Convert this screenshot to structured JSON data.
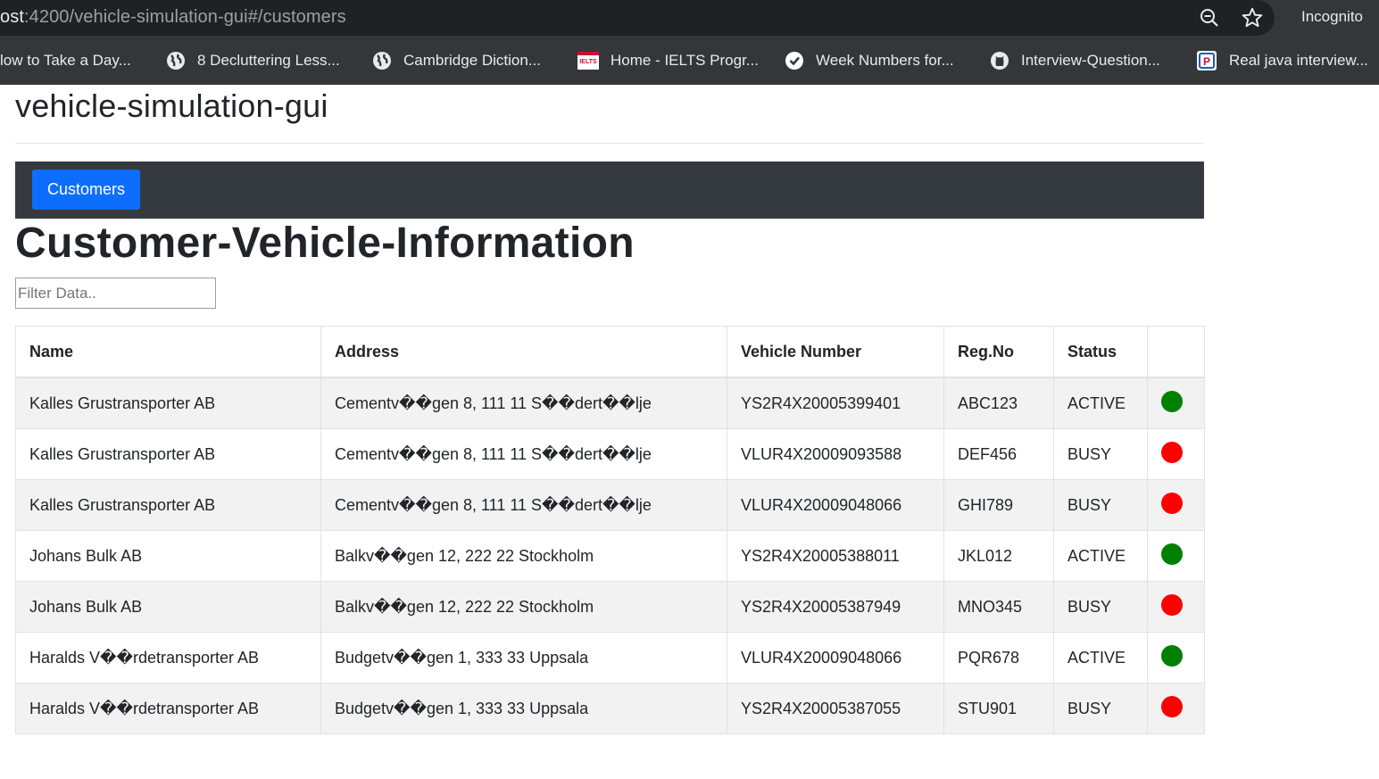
{
  "browser": {
    "url_host": "ost",
    "url_path": ":4200/vehicle-simulation-gui#/customers",
    "mode_label": "Incognito",
    "bookmarks": [
      {
        "label": "low to Take a Day...",
        "icon": "none"
      },
      {
        "label": "8 Decluttering Less...",
        "icon": "globe-icon"
      },
      {
        "label": "Cambridge Diction...",
        "icon": "globe-icon"
      },
      {
        "label": "Home - IELTS Progr...",
        "icon": "ielts-icon"
      },
      {
        "label": "Week Numbers for...",
        "icon": "check-circle-icon"
      },
      {
        "label": "Interview-Question...",
        "icon": "github-icon"
      },
      {
        "label": "Real java interview...",
        "icon": "p-icon"
      }
    ]
  },
  "app": {
    "title": "vehicle-simulation-gui",
    "nav": {
      "customers_label": "Customers"
    },
    "heading": "Customer-Vehicle-Information",
    "filter": {
      "placeholder": "Filter Data..",
      "value": ""
    }
  },
  "table": {
    "headers": [
      "Name",
      "Address",
      "Vehicle Number",
      "Reg.No",
      "Status",
      ""
    ],
    "rows": [
      {
        "name": "Kalles Grustransporter AB",
        "address": "Cementv��gen 8, 111 11 S��dert��lje",
        "vehicle_number": "YS2R4X20005399401",
        "reg_no": "ABC123",
        "status": "ACTIVE",
        "indicator": "green"
      },
      {
        "name": "Kalles Grustransporter AB",
        "address": "Cementv��gen 8, 111 11 S��dert��lje",
        "vehicle_number": "VLUR4X20009093588",
        "reg_no": "DEF456",
        "status": "BUSY",
        "indicator": "red"
      },
      {
        "name": "Kalles Grustransporter AB",
        "address": "Cementv��gen 8, 111 11 S��dert��lje",
        "vehicle_number": "VLUR4X20009048066",
        "reg_no": "GHI789",
        "status": "BUSY",
        "indicator": "red"
      },
      {
        "name": "Johans Bulk AB",
        "address": "Balkv��gen 12, 222 22 Stockholm",
        "vehicle_number": "YS2R4X20005388011",
        "reg_no": "JKL012",
        "status": "ACTIVE",
        "indicator": "green"
      },
      {
        "name": "Johans Bulk AB",
        "address": "Balkv��gen 12, 222 22 Stockholm",
        "vehicle_number": "YS2R4X20005387949",
        "reg_no": "MNO345",
        "status": "BUSY",
        "indicator": "red"
      },
      {
        "name": "Haralds V��rdetransporter AB",
        "address": "Budgetv��gen 1, 333 33 Uppsala",
        "vehicle_number": "VLUR4X20009048066",
        "reg_no": "PQR678",
        "status": "ACTIVE",
        "indicator": "green"
      },
      {
        "name": "Haralds V��rdetransporter AB",
        "address": "Budgetv��gen 1, 333 33 Uppsala",
        "vehicle_number": "YS2R4X20005387055",
        "reg_no": "STU901",
        "status": "BUSY",
        "indicator": "red"
      }
    ]
  },
  "colors": {
    "active": "#008000",
    "busy": "#ff0000",
    "navbar": "#343a40",
    "button": "#0d6efd"
  }
}
